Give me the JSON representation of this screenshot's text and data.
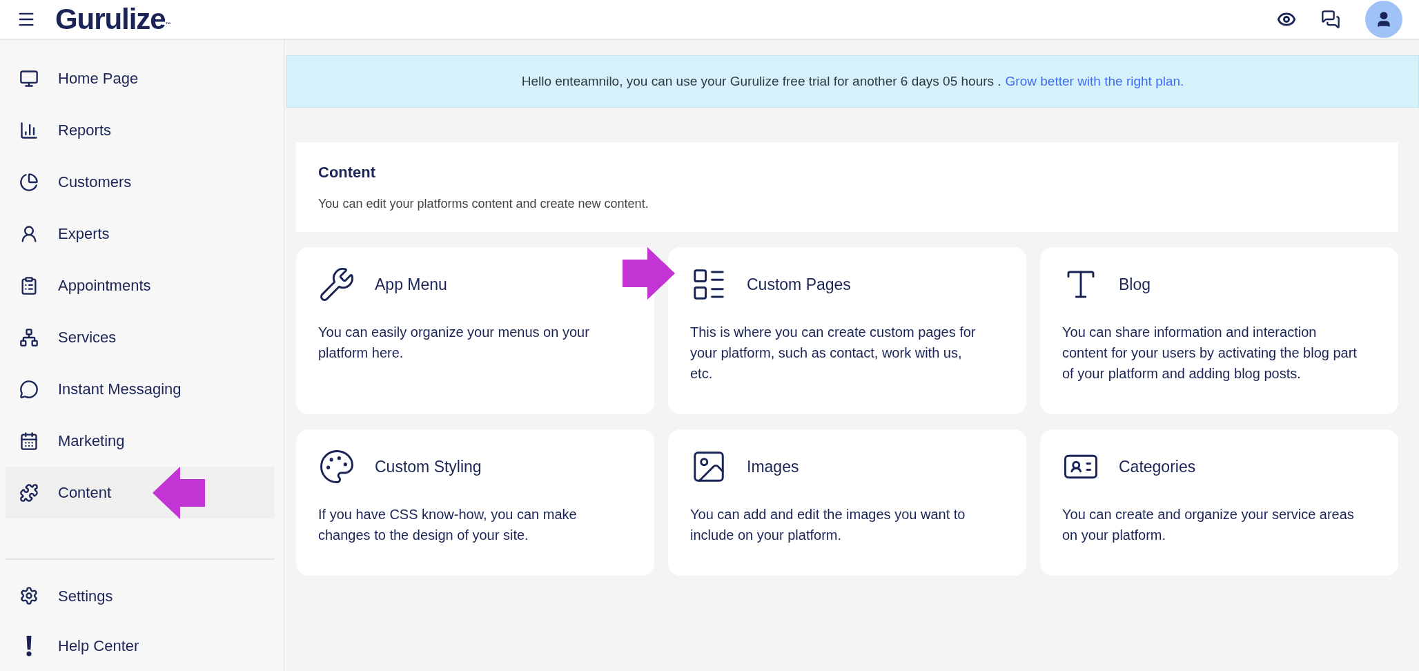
{
  "header": {
    "logo": "Gurulize",
    "logo_mark": "™"
  },
  "sidebar": {
    "items": [
      {
        "label": "Home Page",
        "selected": false
      },
      {
        "label": "Reports",
        "selected": false
      },
      {
        "label": "Customers",
        "selected": false
      },
      {
        "label": "Experts",
        "selected": false
      },
      {
        "label": "Appointments",
        "selected": false
      },
      {
        "label": "Services",
        "selected": false
      },
      {
        "label": "Instant Messaging",
        "selected": false
      },
      {
        "label": "Marketing",
        "selected": false
      },
      {
        "label": "Content",
        "selected": true
      }
    ],
    "bottom_items": [
      {
        "label": "Settings"
      },
      {
        "label": "Help Center"
      }
    ]
  },
  "banner": {
    "text": "Hello enteamnilo, you can use your Gurulize free trial for another 6 days 05 hours .",
    "link": "Grow better with the right plan."
  },
  "content_header": {
    "title": "Content",
    "subtitle": "You can edit your platforms content and create new content."
  },
  "cards": [
    {
      "title": "App Menu",
      "description": "You can easily organize your menus on your platform here."
    },
    {
      "title": "Custom Pages",
      "description": "This is where you can create custom pages for your platform, such as contact, work with us, etc."
    },
    {
      "title": "Blog",
      "description": "You can share information and interaction content for your users by activating the blog part of your platform and adding blog posts."
    },
    {
      "title": "Custom Styling",
      "description": "If you have CSS know-how, you can make changes to the design of your site."
    },
    {
      "title": "Images",
      "description": "You can add and edit the images you want to include on your platform."
    },
    {
      "title": "Categories",
      "description": "You can create and organize your service areas on your platform."
    }
  ]
}
